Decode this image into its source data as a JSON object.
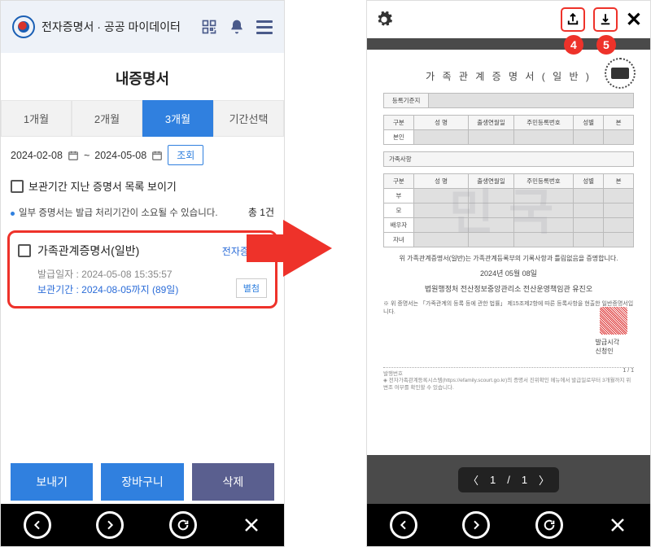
{
  "left": {
    "header_title": "전자증명서 · 공공 마이데이터",
    "page_title": "내증명서",
    "tabs": [
      "1개월",
      "2개월",
      "3개월",
      "기간선택"
    ],
    "active_tab": 2,
    "date_from": "2024-02-08",
    "date_to": "2024-05-08",
    "date_sep": "~",
    "search_btn": "조회",
    "show_expired": "보관기간 지난 증명서 목록 보이기",
    "notice": "일부 증명서는 발급 처리기간이 소요될 수 있습니다.",
    "count": "총 1건",
    "card": {
      "name": "가족관계증명서(일반)",
      "tag": "전자증명서",
      "issued_label": "발급일자 : 2024-05-08 15:35:57",
      "keep_label": "보관기간 : 2024-08-05까지 (89일)",
      "attach": "별첨"
    },
    "actions": {
      "send": "보내기",
      "cart": "장바구니",
      "delete": "삭제"
    }
  },
  "callouts": {
    "c4": "4",
    "c5": "5"
  },
  "doc": {
    "title": "가 족 관 계 증 명 서 ( 일 반 )",
    "row_basis": "등록기준지",
    "headers": [
      "구분",
      "성    명",
      "출생연월일",
      "주민등록번호",
      "성별",
      "본"
    ],
    "row_self": "본인",
    "section_family": "가족사항",
    "family_rows": [
      "부",
      "모",
      "배우자",
      "자녀"
    ],
    "stmt": "위 가족관계증명서(일반)는 가족관계등록부의 기록사항과 틀림없음을 증명합니다.",
    "date": "2024년 05월 08일",
    "issuer": "법원행정처 전산정보중앙관리소 전산운영책임관 유진오",
    "note": "※ 위 증명서는 「가족관계의 등록 등에 관한 법률」 제15조제2항에 따른 등록사항을 현출한 일반증명서입니다.",
    "sig1": "발급시각",
    "sig2": "신청인",
    "foot_label": "발행번호",
    "foot_note": "◈ 전자가족관계등록시스템(https://efamily.scourt.go.kr)의 증명서 진위확인 메뉴에서 발급일로부터 3개월까지 위변조 여부를 확인할 수 있습니다.",
    "page_indicator": "1 / 1"
  },
  "pager": {
    "current": "1",
    "sep": "/",
    "total": "1"
  }
}
